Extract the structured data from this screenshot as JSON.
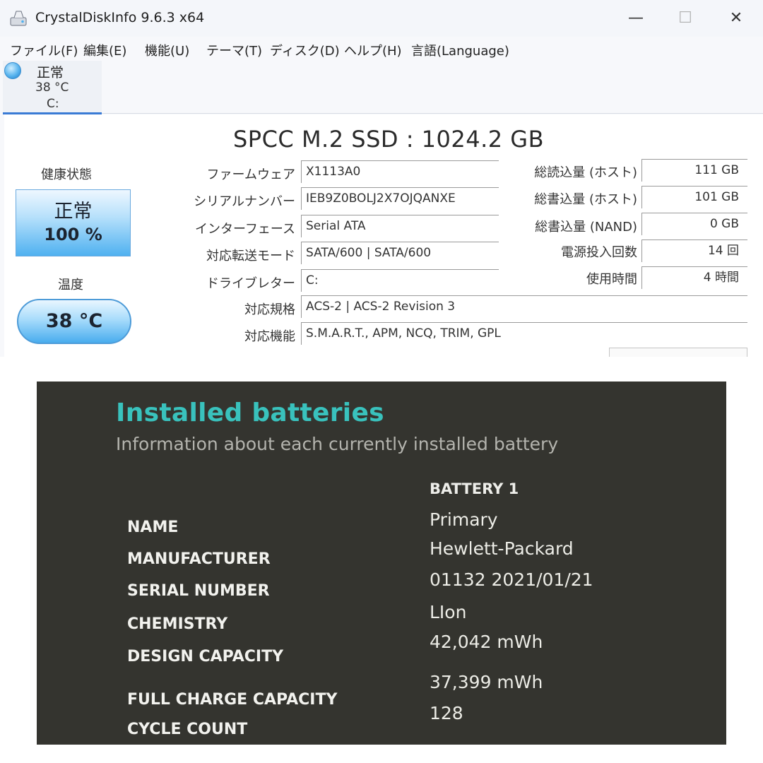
{
  "crystaldisk": {
    "title": "CrystalDiskInfo 9.6.3 x64",
    "window_controls": {
      "minimize": "—",
      "maximize": "☐",
      "close": "✕"
    },
    "menu": [
      "ファイル(F)",
      "編集(E)",
      "機能(U)",
      "テーマ(T)",
      "ディスク(D)",
      "ヘルプ(H)",
      "言語(Language)"
    ],
    "drive_tab": {
      "status": "正常",
      "temperature": "38 °C",
      "letter": "C:"
    },
    "model": "SPCC M.2 SSD : 1024.2 GB",
    "health": {
      "label": "健康状態",
      "status": "正常",
      "percent": "100 %"
    },
    "temperature": {
      "label": "温度",
      "value": "38 °C"
    },
    "fields": [
      {
        "label": "ファームウェア",
        "value": "X1113A0"
      },
      {
        "label": "シリアルナンバー",
        "value": "IEB9Z0BOLJ2X7OJQANXE"
      },
      {
        "label": "インターフェース",
        "value": "Serial ATA"
      },
      {
        "label": "対応転送モード",
        "value": "SATA/600 | SATA/600"
      },
      {
        "label": "ドライブレター",
        "value": "C:"
      },
      {
        "label": "対応規格",
        "value": "ACS-2 | ACS-2 Revision 3"
      },
      {
        "label": "対応機能",
        "value": "S.M.A.R.T., APM, NCQ, TRIM, GPL"
      }
    ],
    "stats": [
      {
        "label": "総読込量 (ホスト)",
        "value": "111 GB"
      },
      {
        "label": "総書込量 (ホスト)",
        "value": "101 GB"
      },
      {
        "label": "総書込量 (NAND)",
        "value": "0 GB"
      },
      {
        "label": "電源投入回数",
        "value": "14 回"
      },
      {
        "label": "使用時間",
        "value": "4 時間"
      }
    ],
    "colors": {
      "status_blue": "#4fb1f0",
      "tab_accent": "#3a7bd5"
    }
  },
  "battery_report": {
    "title": "Installed batteries",
    "subtitle": "Information about each currently installed battery",
    "column_header": "BATTERY 1",
    "rows": [
      {
        "label": "NAME",
        "value": "Primary"
      },
      {
        "label": "MANUFACTURER",
        "value": "Hewlett-Packard"
      },
      {
        "label": "SERIAL NUMBER",
        "value": "01132 2021/01/21"
      },
      {
        "label": "CHEMISTRY",
        "value": "LIon"
      },
      {
        "label": "DESIGN CAPACITY",
        "value": "42,042 mWh"
      },
      {
        "label": "FULL CHARGE CAPACITY",
        "value": "37,399 mWh"
      },
      {
        "label": "CYCLE COUNT",
        "value": "128"
      }
    ],
    "colors": {
      "background": "#34342f",
      "title": "#39c2bd"
    }
  }
}
